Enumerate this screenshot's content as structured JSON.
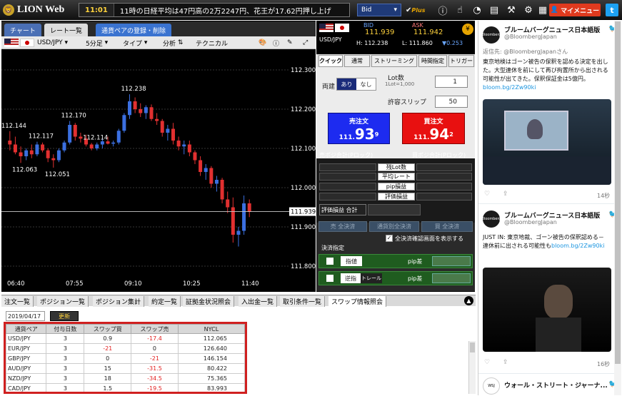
{
  "topbar": {
    "logo": "LION Web",
    "time": "11:01",
    "headline": "11時の日経平均は47円高の2万2247円、花王が17.62円押し上げ",
    "price_type": "Bid",
    "plus_logo": "Plus",
    "my_menu": "マイメニュー"
  },
  "chart": {
    "tabs": [
      "チャート",
      "レート一覧",
      "通貨ペアの登録・削除"
    ],
    "pair": "USD/JPY",
    "interval": "5分足",
    "type_label": "タイプ",
    "analysis_label": "分析",
    "technical_label": "テクニカル",
    "y_ticks": [
      "112.300",
      "112.200",
      "112.100",
      "112.000",
      "111.900",
      "111.800"
    ],
    "current_price": "111.939",
    "x_ticks": [
      "06:40",
      "07:55",
      "09:10",
      "10:25",
      "11:40"
    ],
    "annotations": [
      "112.238",
      "112.170",
      "112.144",
      "112.117",
      "112.114",
      "112.063",
      "112.051"
    ]
  },
  "chart_data": {
    "type": "candlestick",
    "title": "USD/JPY 5分足",
    "ylim": [
      111.78,
      112.34
    ],
    "x_ticks": [
      "06:40",
      "07:55",
      "09:10",
      "10:25",
      "11:40"
    ],
    "ohlc": [
      [
        112.12,
        112.144,
        112.095,
        112.11
      ],
      [
        112.11,
        112.13,
        112.085,
        112.09
      ],
      [
        112.09,
        112.105,
        112.063,
        112.08
      ],
      [
        112.08,
        112.1,
        112.07,
        112.095
      ],
      [
        112.095,
        112.11,
        112.075,
        112.085
      ],
      [
        112.085,
        112.117,
        112.08,
        112.11
      ],
      [
        112.11,
        112.115,
        112.09,
        112.095
      ],
      [
        112.095,
        112.1,
        112.065,
        112.075
      ],
      [
        112.075,
        112.085,
        112.051,
        112.07
      ],
      [
        112.07,
        112.1,
        112.065,
        112.095
      ],
      [
        112.095,
        112.12,
        112.09,
        112.115
      ],
      [
        112.115,
        112.17,
        112.11,
        112.16
      ],
      [
        112.16,
        112.165,
        112.12,
        112.13
      ],
      [
        112.13,
        112.14,
        112.115,
        112.125
      ],
      [
        112.125,
        112.135,
        112.105,
        112.11
      ],
      [
        112.11,
        112.114,
        112.095,
        112.1
      ],
      [
        112.1,
        112.115,
        112.095,
        112.11
      ],
      [
        112.11,
        112.125,
        112.1,
        112.118
      ],
      [
        112.118,
        112.13,
        112.11,
        112.112
      ],
      [
        112.112,
        112.12,
        112.105,
        112.115
      ],
      [
        112.115,
        112.15,
        112.11,
        112.145
      ],
      [
        112.145,
        112.19,
        112.14,
        112.185
      ],
      [
        112.185,
        112.238,
        112.175,
        112.22
      ],
      [
        112.22,
        112.23,
        112.19,
        112.2
      ],
      [
        112.2,
        112.215,
        112.18,
        112.19
      ],
      [
        112.19,
        112.21,
        112.175,
        112.205
      ],
      [
        112.205,
        112.212,
        112.17,
        112.175
      ],
      [
        112.175,
        112.19,
        112.16,
        112.17
      ],
      [
        112.17,
        112.175,
        112.13,
        112.14
      ],
      [
        112.14,
        112.16,
        112.12,
        112.15
      ],
      [
        112.15,
        112.165,
        112.11,
        112.12
      ],
      [
        112.12,
        112.13,
        112.095,
        112.105
      ],
      [
        112.105,
        112.12,
        112.085,
        112.11
      ],
      [
        112.11,
        112.12,
        112.08,
        112.09
      ],
      [
        112.09,
        112.095,
        112.06,
        112.07
      ],
      [
        112.07,
        112.08,
        112.03,
        112.04
      ],
      [
        112.04,
        112.06,
        112.02,
        112.05
      ],
      [
        112.05,
        112.055,
        112.0,
        112.01
      ],
      [
        112.01,
        112.03,
        111.99,
        112.02
      ],
      [
        112.02,
        112.025,
        111.96,
        111.97
      ],
      [
        111.97,
        111.99,
        111.935,
        111.95
      ],
      [
        111.95,
        111.975,
        111.86,
        111.88
      ],
      [
        111.88,
        111.9,
        111.85,
        111.89
      ],
      [
        111.89,
        111.98,
        111.88,
        111.96
      ],
      [
        111.96,
        111.97,
        111.925,
        111.939
      ]
    ]
  },
  "quote": {
    "pair": "USD/JPY",
    "bid_label": "BID",
    "ask_label": "ASK",
    "bid": "111.939",
    "ask": "111.942",
    "high": "H: 112.238",
    "low": "L: 111.860",
    "change": "▼0.253"
  },
  "order": {
    "tabs": [
      "クイック",
      "通常",
      "ストリーミング",
      "時間指定",
      "トリガー"
    ],
    "both_label": "両建",
    "both_on": "あり",
    "both_off": "なし",
    "lot_label": "Lot数",
    "lot_note": "1Lot=1,000",
    "lot_value": "1",
    "slip_label": "許容スリップ",
    "slip_value": "50",
    "sell_label": "売注文",
    "sell_small": "111.",
    "sell_big": "93",
    "sell_sup": "9",
    "buy_label": "買注文",
    "buy_small": "111.",
    "buy_big": "94",
    "buy_sup": "2",
    "sell_pos_label": "売ポジ合計(Pロック)",
    "buy_pos_label": "買ポジ合計(Pロック)",
    "pos_rows": [
      "残Lot数",
      "平均レート",
      "pip損益",
      "評価損益"
    ],
    "total_label": "評価損益 合計",
    "settle_buttons": [
      "売 全決済",
      "通貨別全決済",
      "買 全決済"
    ],
    "show_screen": "全決済確認画面を表示する",
    "settle_spec": "決済指定",
    "limit_label": "指値",
    "stop_label": "逆指",
    "trail_label": "トレール",
    "pip_diff": "pip差"
  },
  "bottom": {
    "tabs": [
      "注文一覧",
      "ポジション一覧",
      "ポジション集計",
      "約定一覧",
      "証拠金状況照会",
      "入出金一覧",
      "取引条件一覧",
      "スワップ情報照会"
    ],
    "date": "2019/04/17",
    "update": "更新",
    "columns": [
      "通貨ペア",
      "付与日数",
      "スワップ買",
      "スワップ売",
      "NYCL"
    ],
    "rows": [
      [
        "USD/JPY",
        "3",
        "0.9",
        "-17.4",
        "112.065"
      ],
      [
        "EUR/JPY",
        "3",
        "-21",
        "0",
        "126.640"
      ],
      [
        "GBP/JPY",
        "3",
        "0",
        "-21",
        "146.154"
      ],
      [
        "AUD/JPY",
        "3",
        "15",
        "-31.5",
        "80.422"
      ],
      [
        "NZD/JPY",
        "3",
        "18",
        "-34.5",
        "75.365"
      ],
      [
        "CAD/JPY",
        "3",
        "1.5",
        "-19.5",
        "83.993"
      ]
    ]
  },
  "twitter": {
    "name": "ブルームバーグニュース日本語版",
    "handle": "@BloombergJapan",
    "t1": {
      "reply": "返信先: @BloombergJapanさん",
      "body": "東京地検はゴーン被告の保釈を認める決定を出した。大型連休を前にして再び拘置所から出される可能性が出てきた。保釈保証金は5億円。",
      "link": "bloom.bg/2Zw90ki",
      "time": "14秒"
    },
    "t2": {
      "body": "JUST IN: 東京地裁、ゴーン被告の保釈認める－連休前に出される可能性も",
      "link": "bloom.bg/2Zw90ki",
      "time": "16秒"
    },
    "t3": {
      "name": "ウォール・ストリート・ジャーナ..."
    },
    "avatar_text": "Bloomberg"
  }
}
